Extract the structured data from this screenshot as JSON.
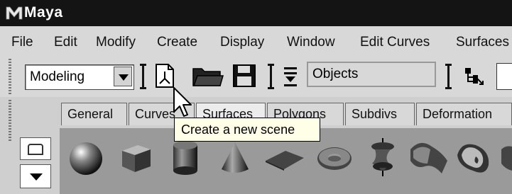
{
  "window": {
    "title": "Maya"
  },
  "menu": [
    "File",
    "Edit",
    "Modify",
    "Create",
    "Display",
    "Window",
    "Edit Curves",
    "Surfaces"
  ],
  "toolbar": {
    "mode_select": "Modeling",
    "selection_mask": "Objects"
  },
  "shelf": {
    "tabs": [
      "General",
      "Curves",
      "Surfaces",
      "Polygons",
      "Subdivs",
      "Deformation"
    ],
    "active_tab": "Surfaces",
    "icons": [
      "sphere",
      "cube",
      "cylinder",
      "cone",
      "plane",
      "torus",
      "revolve",
      "loft",
      "planar",
      "extra"
    ]
  },
  "tooltip": {
    "text": "Create a new scene"
  }
}
